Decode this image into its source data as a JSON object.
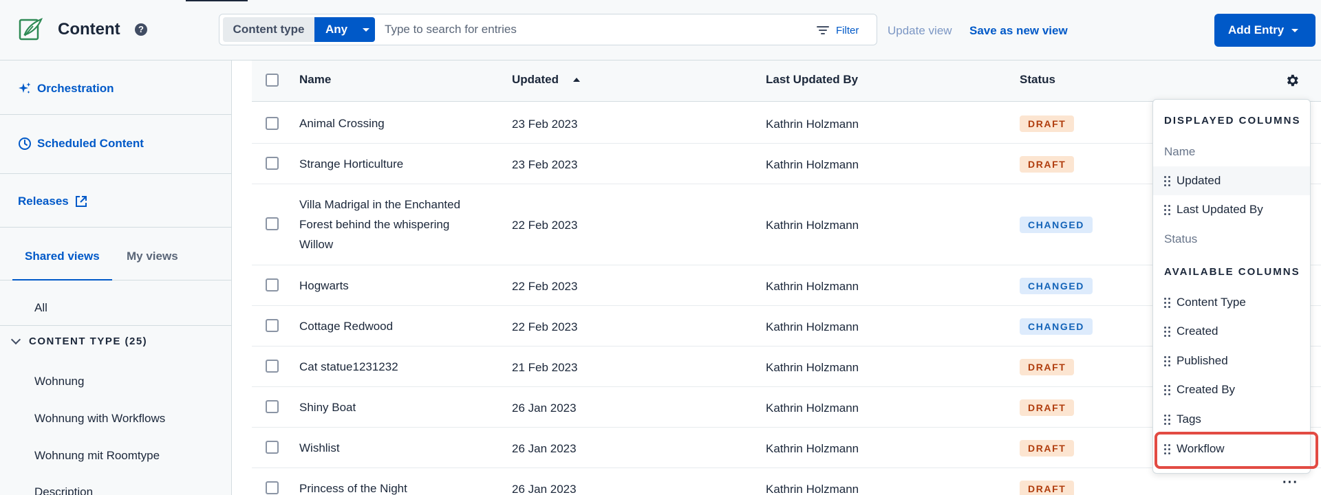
{
  "header": {
    "title": "Content",
    "help_icon": "?",
    "search": {
      "content_type_label": "Content type",
      "content_type_value": "Any",
      "placeholder": "Type to search for entries",
      "filter_label": "Filter"
    },
    "update_view_label": "Update view",
    "save_view_label": "Save as new view",
    "add_entry_label": "Add Entry"
  },
  "sidebar": {
    "links": [
      {
        "label": "Orchestration",
        "icon": "sparkles-icon"
      },
      {
        "label": "Scheduled Content",
        "icon": "clock-icon"
      },
      {
        "label": "Releases",
        "icon": "external-link-icon"
      }
    ],
    "tabs": [
      {
        "label": "Shared views",
        "active": true
      },
      {
        "label": "My views",
        "active": false
      }
    ],
    "all_label": "All",
    "content_type_section": "CONTENT TYPE (25)",
    "content_types": [
      "Wohnung",
      "Wohnung with Workflows",
      "Wohnung mit Roomtype",
      "Description"
    ]
  },
  "table": {
    "columns": {
      "name": "Name",
      "updated": "Updated",
      "by": "Last Updated By",
      "status": "Status"
    },
    "rows": [
      {
        "name": "Animal Crossing",
        "updated": "23 Feb 2023",
        "by": "Kathrin Holzmann",
        "status": "DRAFT"
      },
      {
        "name": "Strange Horticulture",
        "updated": "23 Feb 2023",
        "by": "Kathrin Holzmann",
        "status": "DRAFT"
      },
      {
        "name": "Villa Madrigal in the Enchanted Forest behind the whispering Willow",
        "updated": "22 Feb 2023",
        "by": "Kathrin Holzmann",
        "status": "CHANGED"
      },
      {
        "name": "Hogwarts",
        "updated": "22 Feb 2023",
        "by": "Kathrin Holzmann",
        "status": "CHANGED"
      },
      {
        "name": "Cottage Redwood",
        "updated": "22 Feb 2023",
        "by": "Kathrin Holzmann",
        "status": "CHANGED"
      },
      {
        "name": "Cat statue1231232",
        "updated": "21 Feb 2023",
        "by": "Kathrin Holzmann",
        "status": "DRAFT"
      },
      {
        "name": "Shiny Boat",
        "updated": "26 Jan 2023",
        "by": "Kathrin Holzmann",
        "status": "DRAFT"
      },
      {
        "name": "Wishlist",
        "updated": "26 Jan 2023",
        "by": "Kathrin Holzmann",
        "status": "DRAFT"
      },
      {
        "name": "Princess of the Night",
        "updated": "26 Jan 2023",
        "by": "Kathrin Holzmann",
        "status": "DRAFT"
      }
    ],
    "more_icon": "···"
  },
  "column_menu": {
    "displayed_heading": "DISPLAYED COLUMNS",
    "displayed": [
      {
        "label": "Name",
        "draggable": false
      },
      {
        "label": "Updated",
        "draggable": true
      },
      {
        "label": "Last Updated By",
        "draggable": true
      },
      {
        "label": "Status",
        "draggable": false
      }
    ],
    "available_heading": "AVAILABLE COLUMNS",
    "available": [
      "Content Type",
      "Created",
      "Published",
      "Created By",
      "Tags",
      "Workflow"
    ]
  },
  "colors": {
    "accent": "#0059c8",
    "draft_bg": "#fce5d1",
    "draft_text": "#b03d0e",
    "changed_bg": "#ddebfc",
    "changed_text": "#1363b8",
    "highlight": "#e24b43"
  }
}
